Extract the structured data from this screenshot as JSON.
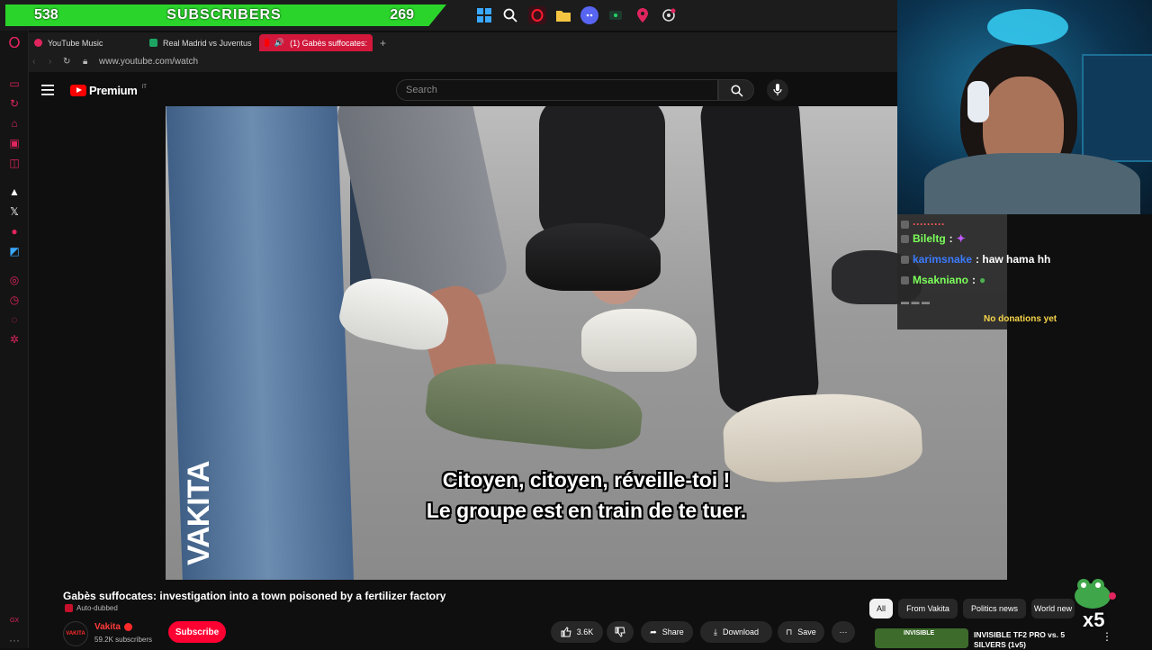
{
  "subs_banner": {
    "left_count": "538",
    "label": "SUBSCRIBERS",
    "right_count": "269"
  },
  "browser": {
    "tabs": [
      {
        "label": "YouTube Music",
        "color": "#e0245e"
      },
      {
        "label": "Real Madrid vs Juventus",
        "color": "#1da462"
      },
      {
        "label": "(1) Gabès suffocates:",
        "color": "#ff0000",
        "active": true
      }
    ],
    "new_tab": "+",
    "url": "www.youtube.com/watch"
  },
  "youtube": {
    "logo_word": "Premium",
    "logo_region": "IT",
    "search_placeholder": "Search",
    "subtitle_line1": "Citoyen, citoyen, réveille-toi !",
    "subtitle_line2": "Le groupe est en train de te tuer.",
    "watermark": "VAKITA",
    "video_title": "Gabès suffocates: investigation into a town poisoned by a fertilizer factory",
    "auto_dubbed": "Auto-dubbed",
    "channel_name": "Vakita",
    "channel_avatar_text": "VAKITA",
    "subscriber_count": "59.2K subscribers",
    "subscribe_label": "Subscribe",
    "like_count": "3.6K",
    "share_label": "Share",
    "download_label": "Download",
    "save_label": "Save",
    "more_label": "···",
    "chips": [
      "All",
      "From Vakita",
      "Politics news",
      "World new"
    ],
    "recommendation": {
      "title": "INVISIBLE TF2 PRO vs. 5 SILVERS (1v5)",
      "thumb_text": "INVISIBLE"
    }
  },
  "stream_overlay": {
    "chat": [
      {
        "user": "Bileltg",
        "color": "#7cff5a",
        "message": ":"
      },
      {
        "user": "karimsnake",
        "color": "#3c7bff",
        "message": ": haw hama hh"
      },
      {
        "user": "Msakniano",
        "color": "#7cff5a",
        "message": ":"
      }
    ],
    "donations": "No donations yet",
    "multiplier": "x5"
  }
}
